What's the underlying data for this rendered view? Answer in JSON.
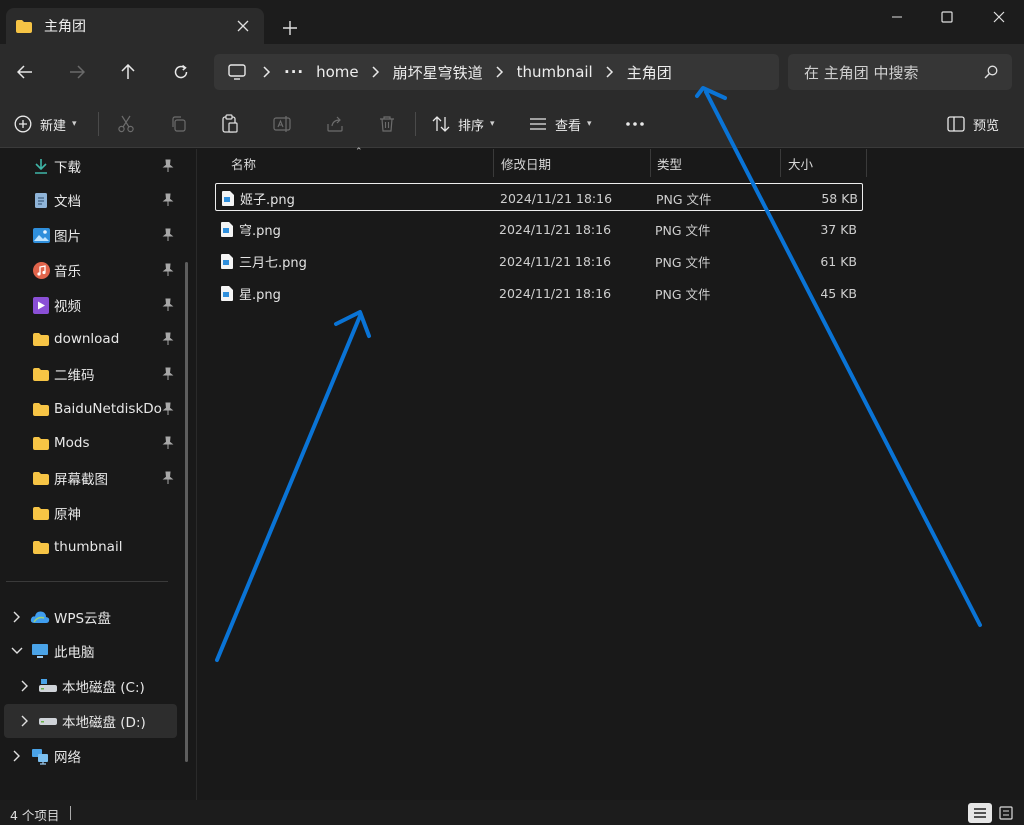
{
  "tab": {
    "title": "主角团"
  },
  "window": {
    "minimize": "—",
    "maximize": "☐",
    "close": "✕"
  },
  "breadcrumb": {
    "items": [
      "home",
      "崩坏星穹铁道",
      "thumbnail",
      "主角团"
    ]
  },
  "search": {
    "placeholder": "在 主角团 中搜索"
  },
  "toolbar": {
    "new_label": "新建",
    "sort_label": "排序",
    "view_label": "查看",
    "preview_label": "预览"
  },
  "sidebar": {
    "quick_access": [
      {
        "label": "下载",
        "icon": "download-icon",
        "pinned": true
      },
      {
        "label": "文档",
        "icon": "document-icon",
        "pinned": true
      },
      {
        "label": "图片",
        "icon": "picture-icon",
        "pinned": true
      },
      {
        "label": "音乐",
        "icon": "music-icon",
        "pinned": true
      },
      {
        "label": "视频",
        "icon": "video-icon",
        "pinned": true
      },
      {
        "label": "download",
        "icon": "folder-icon",
        "pinned": true
      },
      {
        "label": "二维码",
        "icon": "folder-icon",
        "pinned": true
      },
      {
        "label": "BaiduNetdiskDownload",
        "icon": "folder-icon",
        "pinned": true
      },
      {
        "label": "Mods",
        "icon": "folder-icon",
        "pinned": true
      },
      {
        "label": "屏幕截图",
        "icon": "folder-icon",
        "pinned": true
      },
      {
        "label": "原神",
        "icon": "folder-icon",
        "pinned": false
      },
      {
        "label": "thumbnail",
        "icon": "folder-icon",
        "pinned": false
      }
    ],
    "tree": [
      {
        "label": "WPS云盘",
        "icon": "cloud-icon",
        "expanded": false
      },
      {
        "label": "此电脑",
        "icon": "computer-icon",
        "expanded": true
      },
      {
        "label": "本地磁盘 (C:)",
        "icon": "drive-icon",
        "expanded": false
      },
      {
        "label": "本地磁盘 (D:)",
        "icon": "drive-icon",
        "expanded": false,
        "selected": true
      },
      {
        "label": "网络",
        "icon": "network-icon",
        "expanded": false
      }
    ]
  },
  "columns": {
    "name": "名称",
    "modified": "修改日期",
    "type": "类型",
    "size": "大小"
  },
  "files": [
    {
      "name": "姬子.png",
      "modified": "2024/11/21 18:16",
      "type": "PNG 文件",
      "size": "58 KB",
      "selected": true
    },
    {
      "name": "穹.png",
      "modified": "2024/11/21 18:16",
      "type": "PNG 文件",
      "size": "37 KB"
    },
    {
      "name": "三月七.png",
      "modified": "2024/11/21 18:16",
      "type": "PNG 文件",
      "size": "61 KB"
    },
    {
      "name": "星.png",
      "modified": "2024/11/21 18:16",
      "type": "PNG 文件",
      "size": "45 KB"
    }
  ],
  "status": {
    "item_count": "4 个项目"
  },
  "colors": {
    "accent": "#0078d4",
    "folder": "#f6c445",
    "annotation": "#0a74d6"
  }
}
